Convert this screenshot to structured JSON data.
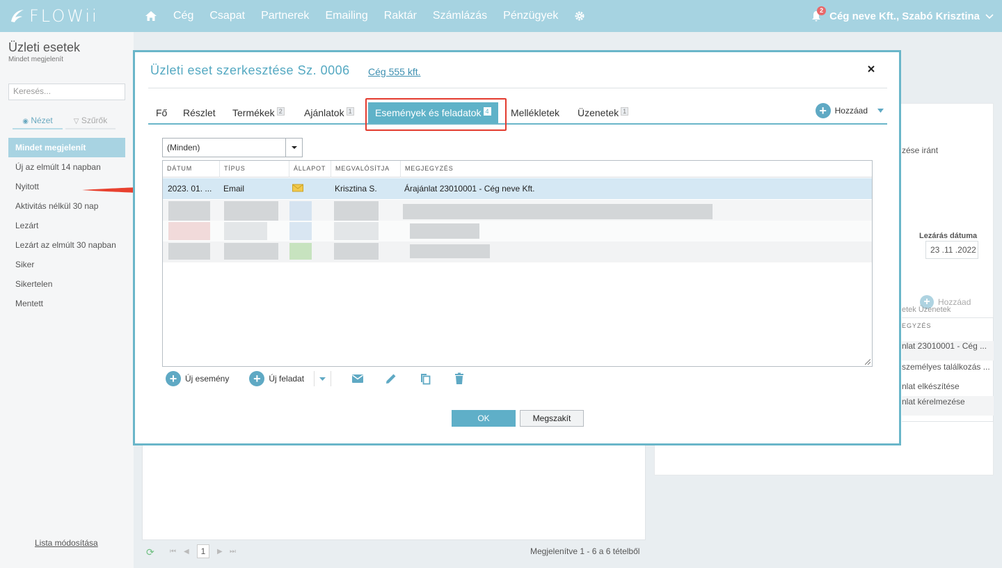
{
  "app": {
    "logo": "FLOWii",
    "nav": [
      "Cég",
      "Csapat",
      "Partnerek",
      "Emailing",
      "Raktár",
      "Számlázás",
      "Pénzügyek"
    ],
    "notifications": "2",
    "user": "Cég neve Kft., Szabó Krisztina"
  },
  "sidebar": {
    "title": "Üzleti esetek",
    "subtitle": "Mindet megjelenít",
    "search_placeholder": "Keresés...",
    "tab_view": "Nézet",
    "tab_filters": "Szűrők",
    "items": [
      "Mindet megjelenít",
      "Új az elmúlt 14 napban",
      "Nyitott",
      "Aktivitás nélkül 30 nap",
      "Lezárt",
      "Lezárt az elmúlt 30 napban",
      "Siker",
      "Sikertelen",
      "Mentett"
    ],
    "footer": "Lista módosítása"
  },
  "background": {
    "text_interest": "zése iránt",
    "close_date_label": "Lezárás dátuma",
    "close_date_value": "23 .11 .2022",
    "add": "Hozzáad",
    "tab_fragment": "etek  Üzenetek",
    "col_fragment": "EGYZÉS",
    "rows": [
      "nlat 23010001 - Cég ...",
      "személyes találkozás ...",
      "nlat elkészítése",
      "nlat kérelmezése"
    ],
    "pager_info": "Megjelenítve 1 - 6 a 6 tételből",
    "page": "1"
  },
  "modal": {
    "title": "Üzleti eset szerkesztése Sz. 0006",
    "company_link": "Cég 555 kft.",
    "tabs": [
      {
        "label": "Fő",
        "badge": ""
      },
      {
        "label": "Részlet",
        "badge": ""
      },
      {
        "label": "Termékek",
        "badge": "2"
      },
      {
        "label": "Ajánlatok",
        "badge": "1"
      },
      {
        "label": "Események és feladatok",
        "badge": "4"
      },
      {
        "label": "Mellékletek",
        "badge": ""
      },
      {
        "label": "Üzenetek",
        "badge": "1"
      }
    ],
    "add_label": "Hozzáad",
    "filter_value": "(Minden)",
    "columns": [
      "DÁTUM",
      "TÍPUS",
      "ÁLLAPOT",
      "MEGVALÓSÍTJA",
      "MEGJEGYZÉS"
    ],
    "row": {
      "date": "2023. 01. ...",
      "type": "Email",
      "assignee": "Krisztina S.",
      "note": "Árajánlat 23010001 - Cég neve Kft."
    },
    "new_event": "Új esemény",
    "new_task": "Új feladat",
    "ok": "OK",
    "cancel": "Megszakít"
  },
  "colors": {
    "accent": "#5fb2c8",
    "topbar": "#a6d3e1",
    "highlight": "#e33b2e"
  }
}
